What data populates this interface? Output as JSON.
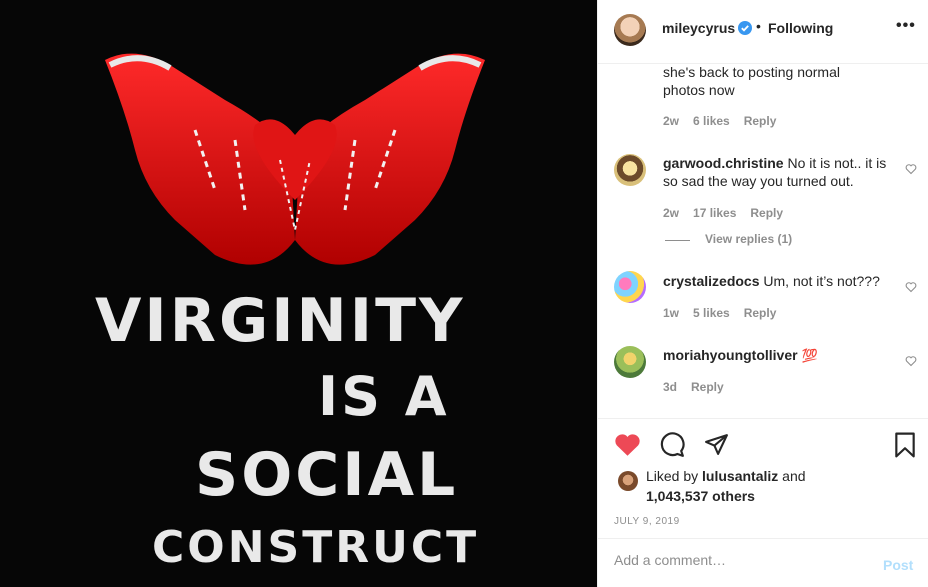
{
  "post": {
    "headline_lines": [
      "VIRGINITY",
      "IS A",
      "SOCIAL",
      "CONSTRUCT"
    ]
  },
  "header": {
    "username": "mileycyrus",
    "separator": "•",
    "follow_state": "Following",
    "more_glyph": "•••"
  },
  "comments": [
    {
      "text": "she's back to posting normal photos now",
      "age": "2w",
      "likes": "6 likes",
      "reply": "Reply"
    },
    {
      "username": "garwood.christine",
      "text": "No it is not.. it is so sad the way you turned out.",
      "age": "2w",
      "likes": "17 likes",
      "reply": "Reply",
      "view_replies": "View replies (1)"
    },
    {
      "username": "crystalizedocs",
      "text": "Um, not it’s not???",
      "age": "1w",
      "likes": "5 likes",
      "reply": "Reply"
    },
    {
      "username": "moriahyoungtolliver",
      "text": "💯",
      "age": "3d",
      "reply": "Reply"
    }
  ],
  "actions": {
    "liked_prefix": "Liked by",
    "liked_user": "lulusantaliz",
    "liked_and": "and",
    "liked_others": "1,043,537 others",
    "date": "JULY 9, 2019"
  },
  "add_comment": {
    "placeholder": "Add a comment…",
    "post_label": "Post"
  },
  "colors": {
    "like_red": "#ed4956",
    "verified_blue": "#3897f0",
    "post_disabled": "#b2dffc"
  }
}
